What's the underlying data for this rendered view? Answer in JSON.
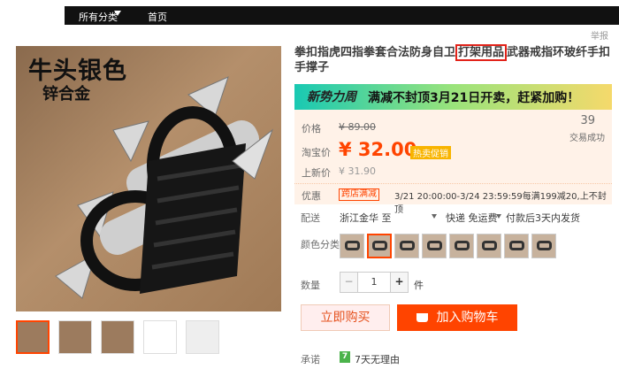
{
  "nav": {
    "category_label": "所有分类",
    "home_label": "首页"
  },
  "report_label": "举报",
  "product_image": {
    "title_line1": "牛头银色",
    "title_line2": "锌合金"
  },
  "product": {
    "title_before": "拳扣指虎四指拳套合法防身自卫",
    "title_highlight": "打架用品",
    "title_after": "武器戒指环玻纤手扣手撑子"
  },
  "banner": {
    "logo_text": "新势力周",
    "text": "满减不封顶3月21日开卖，赶紧加购！"
  },
  "price": {
    "label_price": "价格",
    "original_price": "¥ 89.00",
    "label_taobao": "淘宝价",
    "current_price": "¥ 32.00",
    "promo_tag": "热卖促销",
    "label_new": "上新价",
    "new_price": "¥ 31.90"
  },
  "sales": {
    "count": "39",
    "label": "交易成功"
  },
  "promotion": {
    "label": "优惠",
    "tag": "跨店满减",
    "desc": "3/21 20:00:00-3/24 23:59:59每满199减20,上不封顶"
  },
  "shipping": {
    "label": "配送",
    "from": "浙江金华 至",
    "fee": "快递 免运费",
    "time": "付款后3天内发货"
  },
  "color": {
    "label": "颜色分类",
    "selected_index": 1,
    "count": 8
  },
  "quantity": {
    "label": "数量",
    "value": "1",
    "minus": "−",
    "plus": "+",
    "unit": "件"
  },
  "buttons": {
    "buy_now": "立即购买",
    "add_cart": "加入购物车"
  },
  "promise": {
    "label": "承诺",
    "icon_text": "7",
    "text": "7天无理由"
  },
  "colors": {
    "accent": "#ff4400",
    "price": "#ff4400",
    "highlight_border": "#e2231a"
  }
}
